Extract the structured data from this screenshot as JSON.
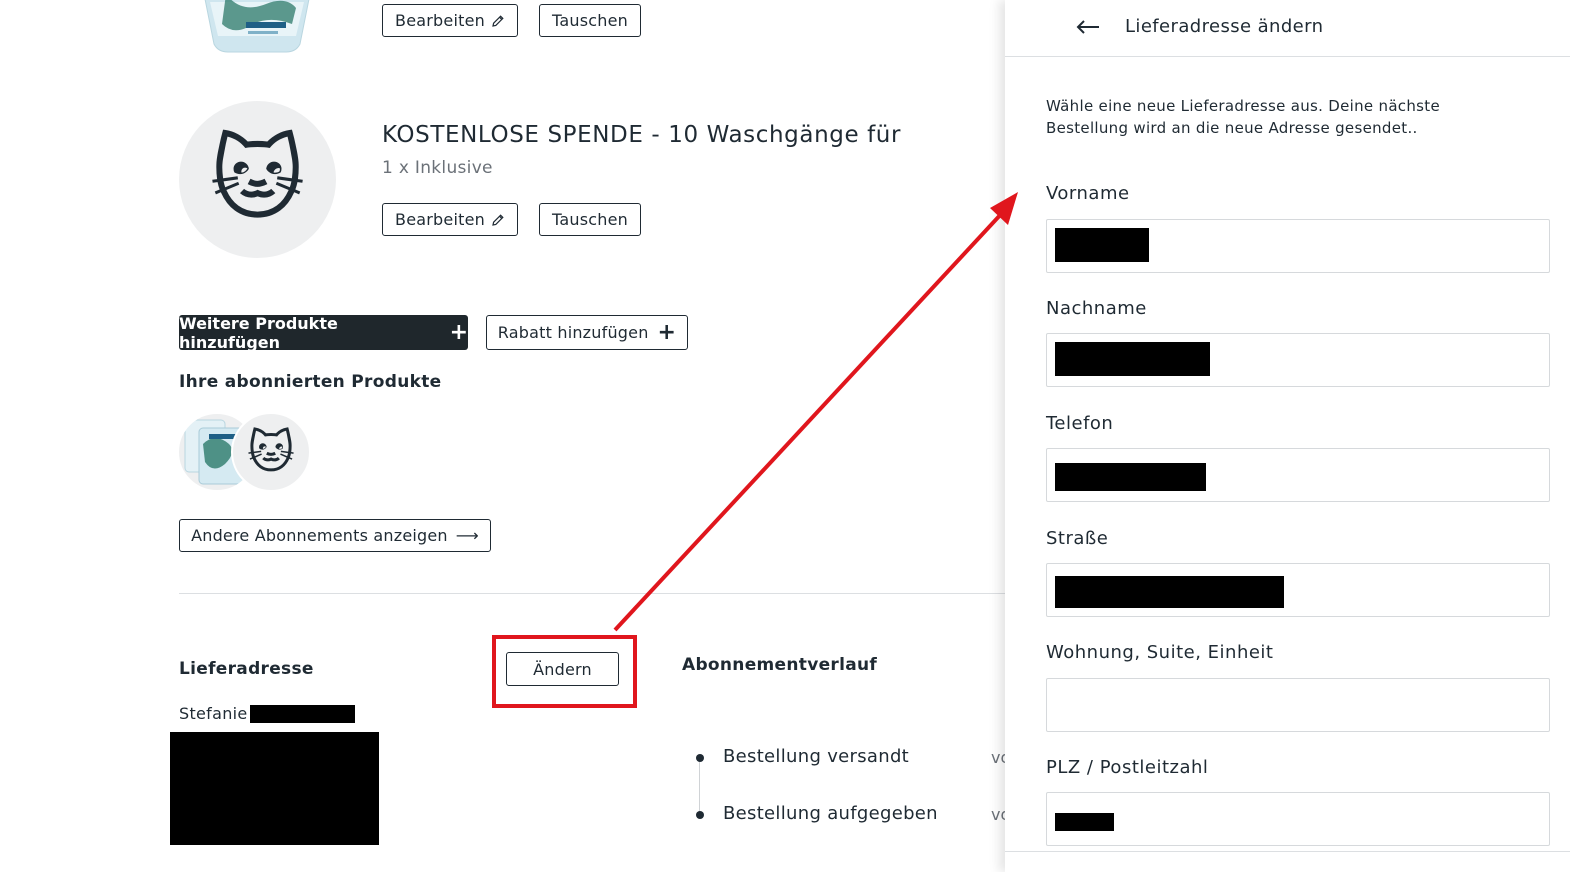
{
  "product_top": {
    "edit_label": "Bearbeiten",
    "swap_label": "Tauschen",
    "image_icon": "detergent-pack-image"
  },
  "product_donation": {
    "title": "KOSTENLOSE SPENDE - 10 Waschgänge für",
    "subtitle": "1 x Inklusive",
    "edit_label": "Bearbeiten",
    "swap_label": "Tauschen",
    "image_icon": "cat-face-emoji",
    "image_glyph": "🐱"
  },
  "actions": {
    "add_products_label": "Weitere Produkte hinzufügen",
    "add_discount_label": "Rabatt hinzufügen",
    "plus_glyph": "+"
  },
  "subscribed": {
    "heading": "Ihre abonnierten Produkte",
    "thumb_2_glyph": "🐱",
    "other_subscriptions_label": "Andere Abonnements anzeigen",
    "arrow_glyph": "⟶"
  },
  "delivery": {
    "heading": "Lieferadresse",
    "change_label": "Ändern",
    "first_name": "Stefanie"
  },
  "history": {
    "heading": "Abonnementverlauf",
    "items": [
      {
        "label": "Bestellung versandt",
        "trailing": "vo"
      },
      {
        "label": "Bestellung aufgegeben",
        "trailing": "vo"
      }
    ]
  },
  "drawer": {
    "title": "Lieferadresse ändern",
    "description": "Wähle eine neue Lieferadresse aus. Deine nächste Bestellung wird an die neue Adresse gesendet..",
    "fields": [
      {
        "label": "Vorname",
        "value_redacted": true
      },
      {
        "label": "Nachname",
        "value_redacted": true
      },
      {
        "label": "Telefon",
        "value_redacted": true
      },
      {
        "label": "Straße",
        "value_redacted": true
      },
      {
        "label": "Wohnung, Suite, Einheit",
        "value_redacted": false
      },
      {
        "label": "PLZ / Postleitzahl",
        "value_redacted": true
      }
    ]
  },
  "colors": {
    "text": "#1f2a33",
    "dark_button": "#1f272c",
    "annotation_red": "#e0161d",
    "image_circle_bg": "#eeeff0"
  }
}
